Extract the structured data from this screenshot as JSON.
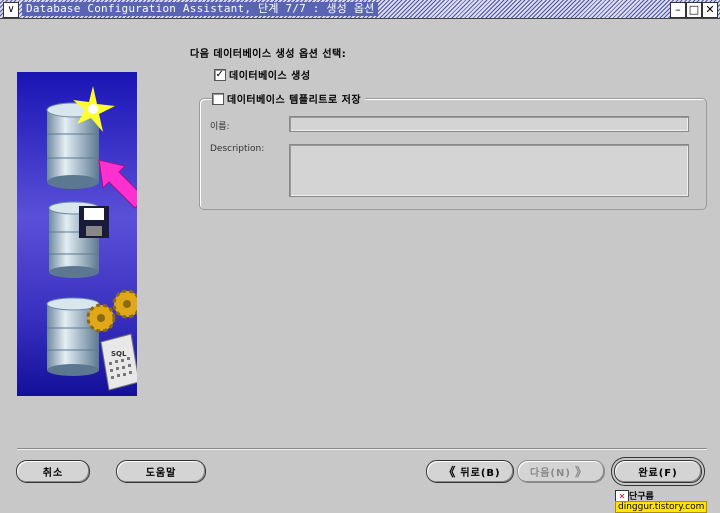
{
  "window": {
    "title": "Database Configuration Assistant, 단계 7/7 : 생성 옵션",
    "menu_glyph": "∨",
    "minimize_glyph": "–",
    "maximize_glyph": "□",
    "close_glyph": "✕"
  },
  "content": {
    "heading": "다음 데이터베이스 생성 옵션 선택:",
    "create_db": {
      "label": "데이터베이스 생성",
      "checked_glyph": "✓"
    },
    "save_template": {
      "label": "데이터베이스 템플리트로 저장",
      "checked_glyph": ""
    },
    "name_label": "이름:",
    "name_value": "",
    "description_label": "Description:",
    "description_value": ""
  },
  "buttons": {
    "cancel": "취소",
    "help": "도움말",
    "back": "뒤로(B)",
    "next": "다음(N)",
    "finish": "완료(F)"
  },
  "overlay": {
    "mark_label": "단구름",
    "watermark": "dinggur.tistory.com"
  }
}
